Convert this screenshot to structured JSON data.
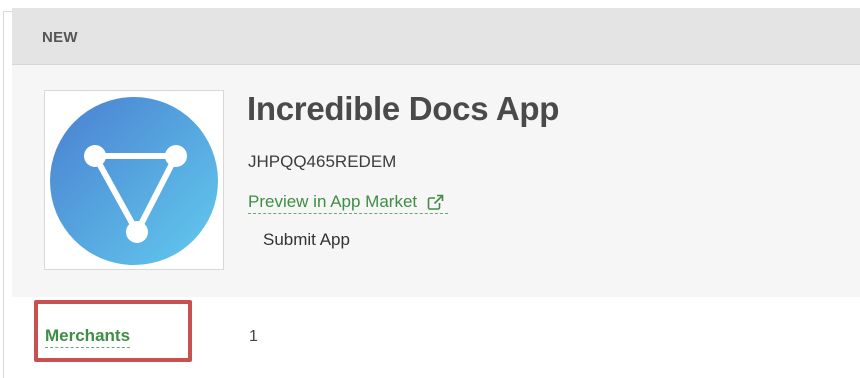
{
  "header": {
    "label": "NEW"
  },
  "app": {
    "title": "Incredible Docs App",
    "id": "JHPQQ465REDEM",
    "preview_link_label": "Preview in App Market",
    "submit_label": "Submit App"
  },
  "merchants": {
    "label": "Merchants",
    "count": "1"
  },
  "icons": {
    "logo": "triangle-nodes-logo",
    "external": "external-link-icon"
  },
  "colors": {
    "link_green": "#3e8e44",
    "highlight_red": "#c85050",
    "logo_gradient_start": "#4f8fd6",
    "logo_gradient_end": "#5cc2ea"
  }
}
